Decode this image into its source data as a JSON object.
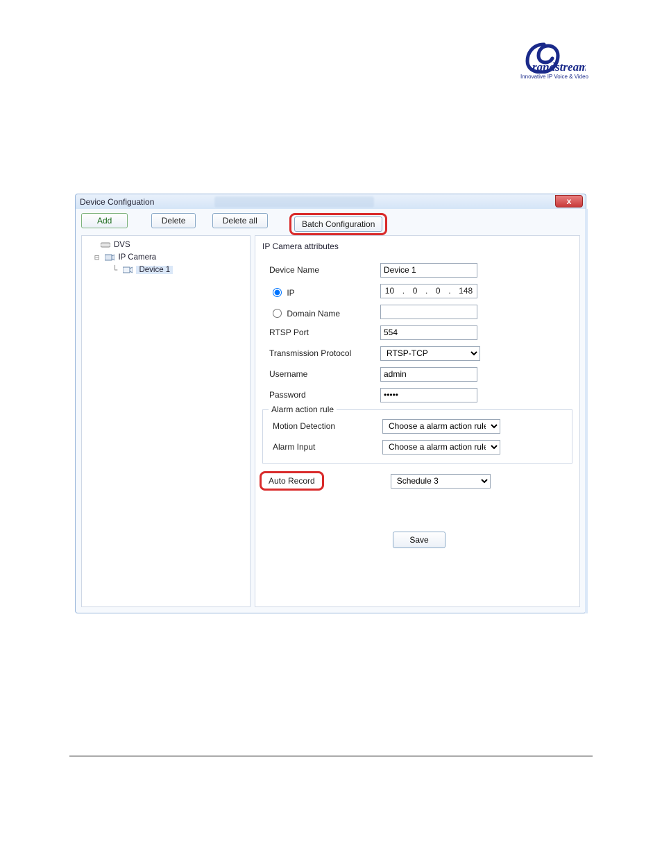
{
  "logo": {
    "tagline": "Innovative IP Voice & Video"
  },
  "window": {
    "title": "Device Configuation",
    "close_label": "x"
  },
  "toolbar": {
    "add": "Add",
    "delete": "Delete",
    "delete_all": "Delete all",
    "batch": "Batch Configuration"
  },
  "tree": {
    "root1": "DVS",
    "root2": "IP Camera",
    "child": "Device 1"
  },
  "attrs": {
    "section_title": "IP Camera attributes",
    "device_name_label": "Device Name",
    "device_name_value": "Device 1",
    "ip_label": "IP",
    "ip_octets": [
      "10",
      "0",
      "0",
      "148"
    ],
    "domain_label": "Domain Name",
    "domain_value": "",
    "rtsp_label": "RTSP Port",
    "rtsp_value": "554",
    "proto_label": "Transmission Protocol",
    "proto_value": "RTSP-TCP",
    "user_label": "Username",
    "user_value": "admin",
    "pass_label": "Password",
    "pass_value": "•••••",
    "alarm_legend": "Alarm action rule",
    "motion_label": "Motion Detection",
    "motion_value": "Choose a alarm action rule",
    "alarmin_label": "Alarm Input",
    "alarmin_value": "Choose a alarm action rule",
    "autorec_label": "Auto Record",
    "autorec_value": "Schedule 3",
    "save": "Save"
  }
}
